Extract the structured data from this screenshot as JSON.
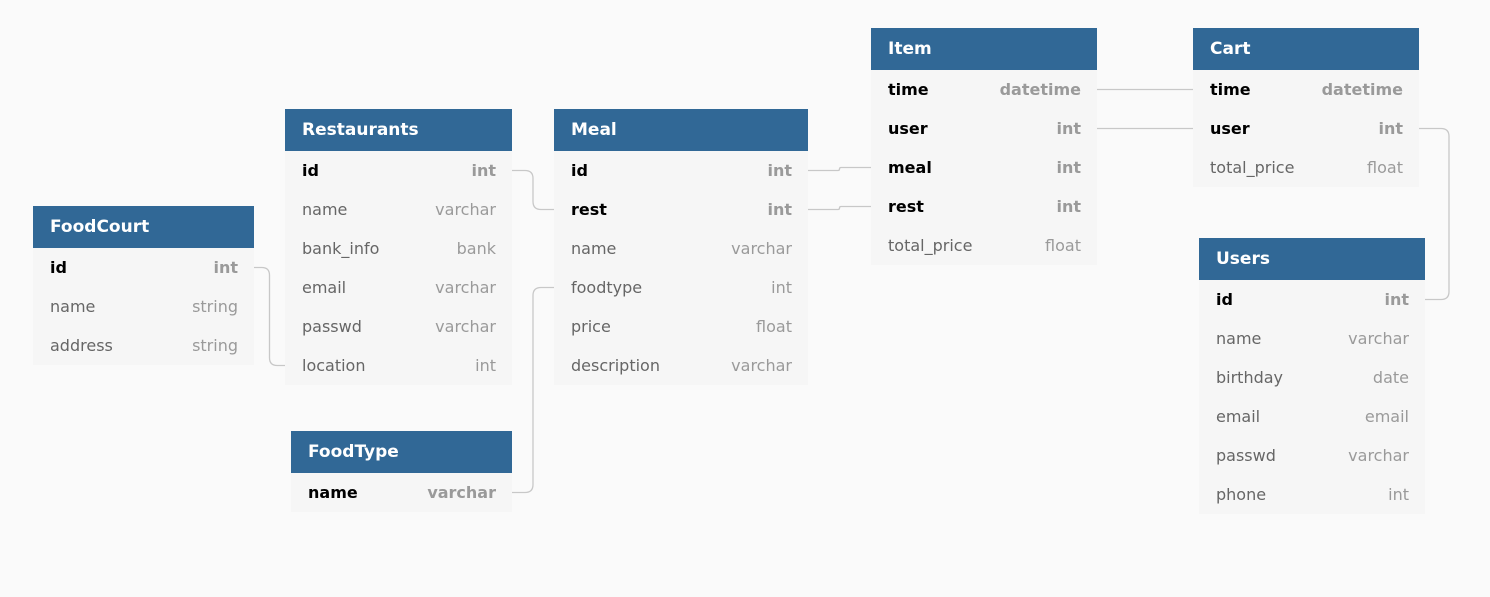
{
  "tables": [
    {
      "id": "foodcourt",
      "title": "FoodCourt",
      "fields": [
        {
          "name": "id",
          "type": "int",
          "key": true
        },
        {
          "name": "name",
          "type": "string",
          "key": false
        },
        {
          "name": "address",
          "type": "string",
          "key": false
        }
      ]
    },
    {
      "id": "restaurants",
      "title": "Restaurants",
      "fields": [
        {
          "name": "id",
          "type": "int",
          "key": true
        },
        {
          "name": "name",
          "type": "varchar",
          "key": false
        },
        {
          "name": "bank_info",
          "type": "bank",
          "key": false
        },
        {
          "name": "email",
          "type": "varchar",
          "key": false
        },
        {
          "name": "passwd",
          "type": "varchar",
          "key": false
        },
        {
          "name": "location",
          "type": "int",
          "key": false
        }
      ]
    },
    {
      "id": "foodtype",
      "title": "FoodType",
      "fields": [
        {
          "name": "name",
          "type": "varchar",
          "key": true
        }
      ]
    },
    {
      "id": "meal",
      "title": "Meal",
      "fields": [
        {
          "name": "id",
          "type": "int",
          "key": true
        },
        {
          "name": "rest",
          "type": "int",
          "key": true
        },
        {
          "name": "name",
          "type": "varchar",
          "key": false
        },
        {
          "name": "foodtype",
          "type": "int",
          "key": false
        },
        {
          "name": "price",
          "type": "float",
          "key": false
        },
        {
          "name": "description",
          "type": "varchar",
          "key": false
        }
      ]
    },
    {
      "id": "item",
      "title": "Item",
      "fields": [
        {
          "name": "time",
          "type": "datetime",
          "key": true
        },
        {
          "name": "user",
          "type": "int",
          "key": true
        },
        {
          "name": "meal",
          "type": "int",
          "key": true
        },
        {
          "name": "rest",
          "type": "int",
          "key": true
        },
        {
          "name": "total_price",
          "type": "float",
          "key": false
        }
      ]
    },
    {
      "id": "cart",
      "title": "Cart",
      "fields": [
        {
          "name": "time",
          "type": "datetime",
          "key": true
        },
        {
          "name": "user",
          "type": "int",
          "key": true
        },
        {
          "name": "total_price",
          "type": "float",
          "key": false
        }
      ]
    },
    {
      "id": "users",
      "title": "Users",
      "fields": [
        {
          "name": "id",
          "type": "int",
          "key": true
        },
        {
          "name": "name",
          "type": "varchar",
          "key": false
        },
        {
          "name": "birthday",
          "type": "date",
          "key": false
        },
        {
          "name": "email",
          "type": "email",
          "key": false
        },
        {
          "name": "passwd",
          "type": "varchar",
          "key": false
        },
        {
          "name": "phone",
          "type": "int",
          "key": false
        }
      ]
    }
  ],
  "relations": [
    {
      "from": [
        "foodcourt",
        "id"
      ],
      "to": [
        "restaurants",
        "location"
      ]
    },
    {
      "from": [
        "restaurants",
        "id"
      ],
      "to": [
        "meal",
        "rest"
      ]
    },
    {
      "from": [
        "foodtype",
        "name"
      ],
      "to": [
        "meal",
        "foodtype"
      ]
    },
    {
      "from": [
        "meal",
        "id"
      ],
      "to": [
        "item",
        "meal"
      ]
    },
    {
      "from": [
        "meal",
        "rest"
      ],
      "to": [
        "item",
        "rest"
      ]
    },
    {
      "from": [
        "item",
        "time"
      ],
      "to": [
        "cart",
        "time"
      ]
    },
    {
      "from": [
        "item",
        "user"
      ],
      "to": [
        "cart",
        "user"
      ]
    },
    {
      "from": [
        "cart",
        "user"
      ],
      "to": [
        "users",
        "id"
      ]
    }
  ],
  "colors": {
    "header": "#316896",
    "header_text": "#ffffff",
    "body": "#f6f6f6",
    "background": "#fafafa",
    "link": "#c8c8c8"
  }
}
